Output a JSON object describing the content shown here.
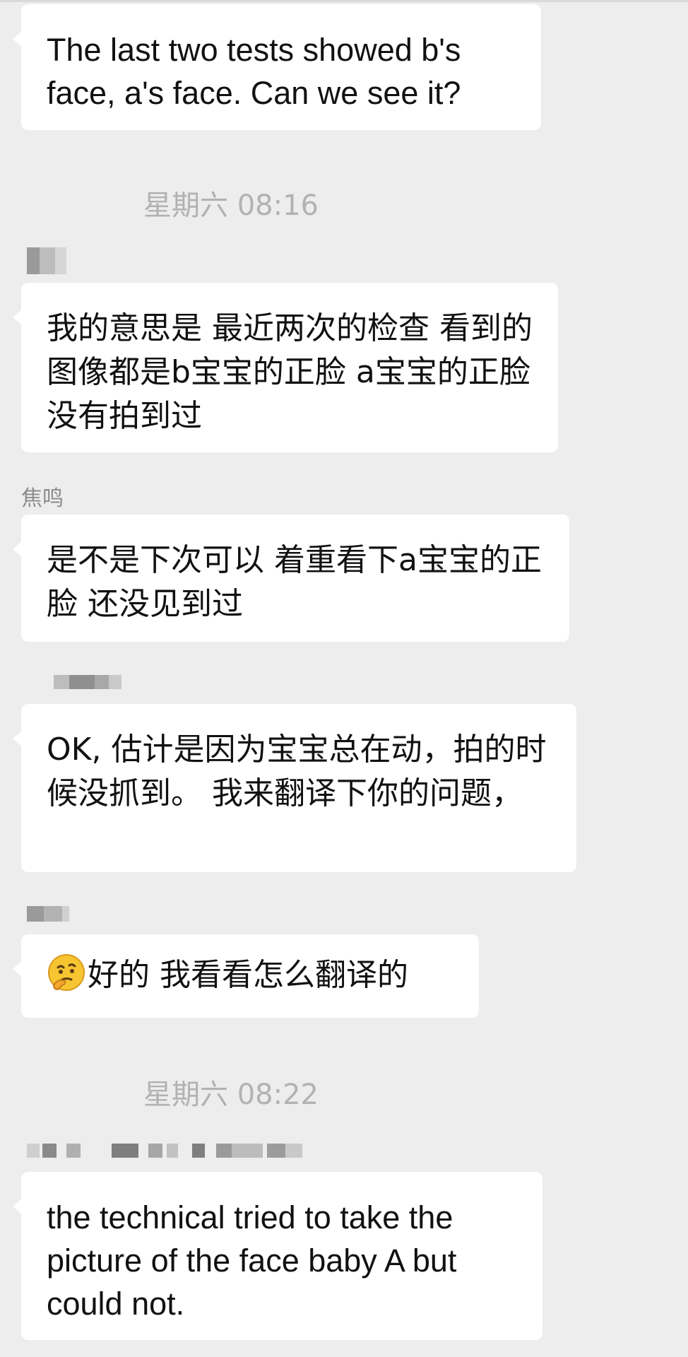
{
  "chat": {
    "messages": [
      {
        "kind": "text",
        "text": "The last two tests showed b's face, a's face. Can we see it?"
      },
      {
        "kind": "time",
        "text": "星期六 08:16"
      },
      {
        "kind": "text",
        "text": "我的意思是 最近两次的检查 看到的图像都是b宝宝的正脸 a宝宝的正脸没有拍到过"
      },
      {
        "kind": "sender",
        "text": "焦鸣"
      },
      {
        "kind": "text",
        "text": "是不是下次可以 着重看下a宝宝的正脸 还没见到过"
      },
      {
        "kind": "text",
        "text": "OK, 估计是因为宝宝总在动，拍的时候没抓到。 我来翻译下你的问题，"
      },
      {
        "kind": "text",
        "text": "好的 我看看怎么翻译的",
        "icon": "thinking-face-emoji-icon"
      },
      {
        "kind": "time",
        "text": "星期六 08:22"
      },
      {
        "kind": "text",
        "text": "the technical tried to take the picture of the face baby A but could not."
      }
    ]
  },
  "colors": {
    "background": "#ededed",
    "bubble": "#ffffff",
    "timestamp": "#b2b2b2",
    "sender_name": "#8c8c8c",
    "redaction_dark": "#808080",
    "redaction_light": "#c8c8c8"
  }
}
